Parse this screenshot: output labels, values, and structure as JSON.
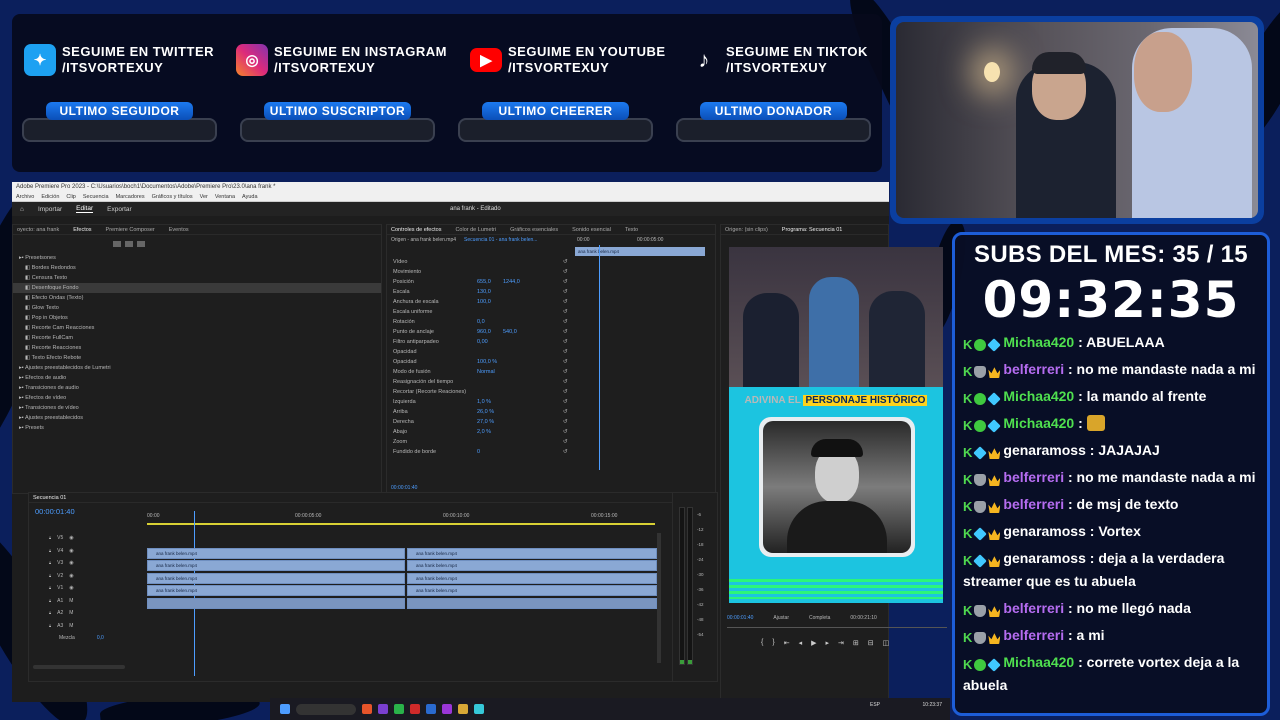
{
  "social": [
    {
      "icon": "twitter-icon",
      "color": "#1da1f2",
      "line1": "SEGUIME EN TWITTER",
      "line2": "/ITSVORTEXUY"
    },
    {
      "icon": "instagram-icon",
      "color": "#e1306c",
      "line1": "SEGUIME EN INSTAGRAM",
      "line2": "/ITSVORTEXUY"
    },
    {
      "icon": "youtube-icon",
      "color": "#ff0000",
      "line1": "SEGUIME EN YOUTUBE",
      "line2": "/ITSVORTEXUY"
    },
    {
      "icon": "tiktok-icon",
      "color": "#000000",
      "line1": "SEGUIME EN TIKTOK",
      "line2": "/ITSVORTEXUY"
    }
  ],
  "stats": [
    "ULTIMO SEGUIDOR",
    "ULTIMO SUSCRIPTOR",
    "ULTIMO CHEERER",
    "ULTIMO DONADOR"
  ],
  "subs": "SUBS DEL MES: 35 / 15",
  "timer": "09:32:35",
  "chat": [
    {
      "badges": [
        "k",
        "g",
        "c"
      ],
      "user": "Michaa420",
      "color": "green",
      "text": " : ABUELAAA"
    },
    {
      "badges": [
        "k",
        "s",
        "w"
      ],
      "user": "belferreri",
      "color": "purple",
      "text": " : no me mandaste nada a mi"
    },
    {
      "badges": [
        "k",
        "g",
        "c"
      ],
      "user": "Michaa420",
      "color": "green",
      "text": " : la mando al frente"
    },
    {
      "badges": [
        "k",
        "g",
        "c"
      ],
      "user": "Michaa420",
      "color": "green",
      "text": " : ",
      "emote": true
    },
    {
      "badges": [
        "k",
        "c",
        "w"
      ],
      "user": "genaramoss",
      "color": "white",
      "text": " : JAJAJAJ"
    },
    {
      "badges": [
        "k",
        "s",
        "w"
      ],
      "user": "belferreri",
      "color": "purple",
      "text": " : no me mandaste nada a mi"
    },
    {
      "badges": [
        "k",
        "s",
        "w"
      ],
      "user": "belferreri",
      "color": "purple",
      "text": " : de msj de texto"
    },
    {
      "badges": [
        "k",
        "c",
        "w"
      ],
      "user": "genaramoss",
      "color": "white",
      "text": " : Vortex"
    },
    {
      "badges": [
        "k",
        "c",
        "w"
      ],
      "user": "genaramoss",
      "color": "white",
      "text": " : deja a la verdadera streamer que es tu abuela"
    },
    {
      "badges": [
        "k",
        "s",
        "w"
      ],
      "user": "belferreri",
      "color": "purple",
      "text": " : no me llegó nada"
    },
    {
      "badges": [
        "k",
        "s",
        "w"
      ],
      "user": "belferreri",
      "color": "purple",
      "text": " : a mi"
    },
    {
      "badges": [
        "k",
        "g",
        "c"
      ],
      "user": "Michaa420",
      "color": "green",
      "text": " : correte vortex deja a la abuela"
    }
  ],
  "premiere": {
    "titlebar": "Adobe Premiere Pro 2023 - C:\\Usuarios\\boch1\\Documentos\\Adobe\\Premiere Pro\\23.0\\ana frank *",
    "menus": [
      "Archivo",
      "Edición",
      "Clip",
      "Secuencia",
      "Marcadores",
      "Gráficos y títulos",
      "Ver",
      "Ventana",
      "Ayuda"
    ],
    "workspace_tabs": [
      "Importar",
      "Editar",
      "Exportar"
    ],
    "project_title": "ana frank",
    "project_subtitle": "Editado",
    "left_tabs": [
      "oyecto: ana frank",
      "Efectos",
      "Premiere Composer",
      "Eventos"
    ],
    "effects_tree": [
      {
        "label": "Presetsones",
        "lvl": 0
      },
      {
        "label": "Bordes Redondos",
        "lvl": 1
      },
      {
        "label": "Censura Texto",
        "lvl": 1
      },
      {
        "label": "Desenfoque Fondo",
        "lvl": 1,
        "sel": true
      },
      {
        "label": "Efecto Ondas (Texto)",
        "lvl": 1
      },
      {
        "label": "Glow Texto",
        "lvl": 1
      },
      {
        "label": "Pop in Objetos",
        "lvl": 1
      },
      {
        "label": "Recorte Cam Reacciones",
        "lvl": 1
      },
      {
        "label": "Recorte FullCam",
        "lvl": 1
      },
      {
        "label": "Recorte Reacciones",
        "lvl": 1
      },
      {
        "label": "Texto Efecto Rebote",
        "lvl": 1
      },
      {
        "label": "Ajustes preestablecidos de Lumetri",
        "lvl": 0
      },
      {
        "label": "Efectos de audio",
        "lvl": 0
      },
      {
        "label": "Transiciones de audio",
        "lvl": 0
      },
      {
        "label": "Efectos de vídeo",
        "lvl": 0
      },
      {
        "label": "Transiciones de vídeo",
        "lvl": 0
      },
      {
        "label": "Ajustes preestablecidos",
        "lvl": 0
      },
      {
        "label": "Presets",
        "lvl": 0
      }
    ],
    "ec_tabs": [
      "Controles de efectos",
      "Color de Lumetri",
      "Gráficos esenciales",
      "Sonido esencial",
      "Texto"
    ],
    "ec_source": "Origen - ana frank belen.mp4",
    "ec_seq": "Secuencia 01 - ana frank belen...",
    "ec_clip": "ana frank belen.mp4",
    "ec_time0": "00:00",
    "ec_time1": "00:00:05:00",
    "ec_rows": [
      {
        "label": "Vídeo",
        "v1": "",
        "v2": ""
      },
      {
        "label": "Movimiento",
        "v1": "",
        "v2": ""
      },
      {
        "label": "Posición",
        "v1": "655,0",
        "v2": "1244,0"
      },
      {
        "label": "Escala",
        "v1": "130,0",
        "v2": ""
      },
      {
        "label": "Anchura de escala",
        "v1": "100,0",
        "v2": ""
      },
      {
        "label": "Escala uniforme",
        "v1": "",
        "v2": ""
      },
      {
        "label": "Rotación",
        "v1": "0,0",
        "v2": ""
      },
      {
        "label": "Punto de anclaje",
        "v1": "960,0",
        "v2": "540,0"
      },
      {
        "label": "Filtro antiparpadeo",
        "v1": "0,00",
        "v2": ""
      },
      {
        "label": "Opacidad",
        "v1": "",
        "v2": ""
      },
      {
        "label": "Opacidad",
        "v1": "100,0 %",
        "v2": ""
      },
      {
        "label": "Modo de fusión",
        "v1": "Normal",
        "v2": ""
      },
      {
        "label": "Reasignación del tiempo",
        "v1": "",
        "v2": ""
      },
      {
        "label": "Recortar (Recorte Reaciones)",
        "v1": "",
        "v2": ""
      },
      {
        "label": "Izquierda",
        "v1": "1,0 %",
        "v2": ""
      },
      {
        "label": "Arriba",
        "v1": "26,0 %",
        "v2": ""
      },
      {
        "label": "Derecha",
        "v1": "27,0 %",
        "v2": ""
      },
      {
        "label": "Abajo",
        "v1": "2,0 %",
        "v2": ""
      },
      {
        "label": "Zoom",
        "v1": "",
        "v2": ""
      },
      {
        "label": "Fundido de borde",
        "v1": "0",
        "v2": ""
      }
    ],
    "ec_timecode": "00:00:01:40",
    "source_tab": "Origen: (sin clips)",
    "program_tab": "Programa: Secuencia 01",
    "program_overlay": "ADIVINA EL",
    "program_overlay_hl": "PERSONAJE HISTÓRICO",
    "program_time": "00:00:01:40",
    "program_fit": "Ajustar",
    "program_quality": "Completa",
    "program_duration": "00:00:21:10",
    "seq_tab": "Secuencia 01",
    "seq_timecode": "00:00:01:40",
    "ruler": [
      "00:00",
      "00:00:05:00",
      "00:00:10:00",
      "00:00:15:00"
    ],
    "tracks": [
      "V5",
      "V4",
      "V3",
      "V2",
      "V1",
      "A1",
      "A2",
      "A3"
    ],
    "mix_label": "Mezcla",
    "mix_value": "0,0",
    "clip_name": "ana frank belen.mp4",
    "meter_labels": [
      "-6",
      "-12",
      "-18",
      "-24",
      "-30",
      "-36",
      "-42",
      "-48",
      "-54"
    ]
  },
  "taskbar": {
    "lang": "ESP",
    "clock": "10:23:37"
  }
}
